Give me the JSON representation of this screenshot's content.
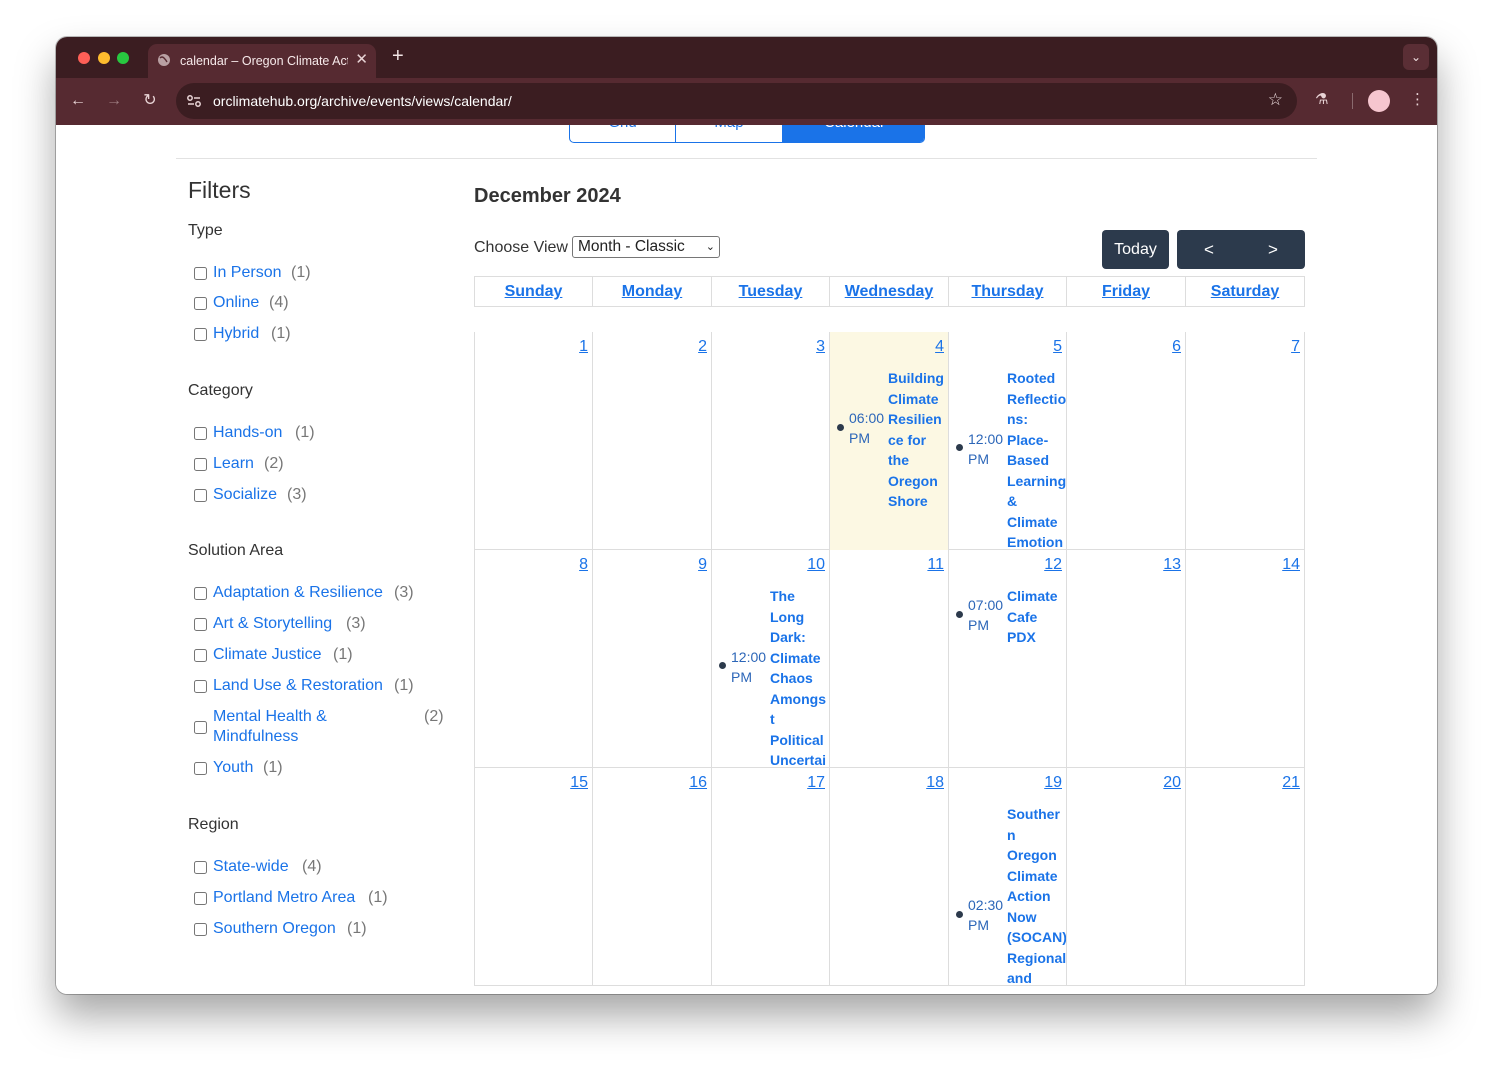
{
  "browser": {
    "tab_title": "calendar – Oregon Climate Action Hub",
    "url": "orclimatehub.org/archive/events/views/calendar/"
  },
  "view_switch": [
    "Grid",
    "Map",
    "Calendar"
  ],
  "filters": {
    "title": "Filters",
    "groups": [
      {
        "title": "Type",
        "items": [
          {
            "label": "In Person",
            "count": "(1)"
          },
          {
            "label": "Online",
            "count": "(4)"
          },
          {
            "label": "Hybrid",
            "count": "(1)"
          }
        ]
      },
      {
        "title": "Category",
        "items": [
          {
            "label": "Hands-on",
            "count": "(1)"
          },
          {
            "label": "Learn",
            "count": "(2)"
          },
          {
            "label": "Socialize",
            "count": "(3)"
          }
        ]
      },
      {
        "title": "Solution Area",
        "items": [
          {
            "label": "Adaptation & Resilience",
            "count": "(3)"
          },
          {
            "label": "Art & Storytelling",
            "count": "(3)"
          },
          {
            "label": "Climate Justice",
            "count": "(1)"
          },
          {
            "label": "Land Use & Restoration",
            "count": "(1)"
          },
          {
            "label": "Mental Health & Mindfulness",
            "count": "(2)"
          },
          {
            "label": "Youth",
            "count": "(1)"
          }
        ]
      },
      {
        "title": "Region",
        "items": [
          {
            "label": "State-wide",
            "count": "(4)"
          },
          {
            "label": "Portland Metro Area",
            "count": "(1)"
          },
          {
            "label": "Southern Oregon",
            "count": "(1)"
          }
        ]
      }
    ]
  },
  "calendar": {
    "month_title": "December 2024",
    "choose_view_label": "Choose View",
    "choose_view_value": "Month - Classic",
    "today_label": "Today",
    "prev_label": "<",
    "next_label": ">",
    "weekdays": [
      "Sunday",
      "Monday",
      "Tuesday",
      "Wednesday",
      "Thursday",
      "Friday",
      "Saturday"
    ],
    "weeks": [
      [
        "1",
        "2",
        "3",
        "4",
        "5",
        "6",
        "7"
      ],
      [
        "8",
        "9",
        "10",
        "11",
        "12",
        "13",
        "14"
      ],
      [
        "15",
        "16",
        "17",
        "18",
        "19",
        "20",
        "21"
      ]
    ],
    "today_date": "4",
    "events": [
      {
        "date": "4",
        "time": "06:00 PM",
        "title": "Building Climate Resilience for the Oregon Shore"
      },
      {
        "date": "5",
        "time": "12:00 PM",
        "title": "Rooted Reflections: Place-Based Learning & Climate Emotions"
      },
      {
        "date": "10",
        "time": "12:00 PM",
        "title": "The Long Dark: Climate Chaos Amongst Political Uncertainty"
      },
      {
        "date": "12",
        "time": "07:00 PM",
        "title": "Climate Cafe PDX"
      },
      {
        "date": "19",
        "time": "02:30 PM",
        "title": "Southern Oregon Climate Action Now (SOCAN) Regional and Local Project"
      }
    ]
  }
}
